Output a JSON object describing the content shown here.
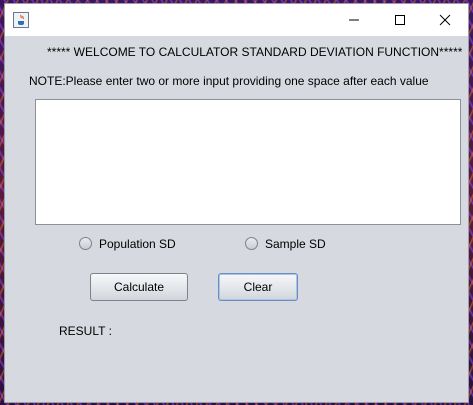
{
  "window": {
    "icon": "java-cup-icon",
    "controls": [
      "minimize-icon",
      "maximize-icon",
      "close-icon"
    ]
  },
  "header": {
    "welcome": "***** WELCOME TO CALCULATOR STANDARD DEVIATION FUNCTION*****",
    "note": "NOTE:Please enter two or more input providing one space after each value"
  },
  "input": {
    "value": ""
  },
  "options": {
    "population_label": "Population SD",
    "sample_label": "Sample SD"
  },
  "buttons": {
    "calculate_label": "Calculate",
    "clear_label": "Clear"
  },
  "result": {
    "label": "RESULT :"
  }
}
